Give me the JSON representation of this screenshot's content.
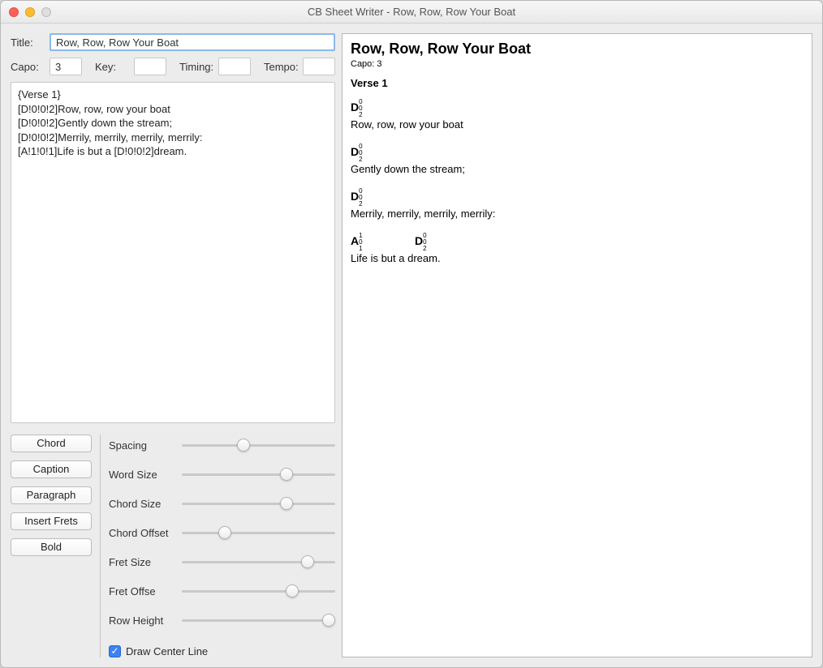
{
  "window": {
    "title": "CB Sheet Writer - Row, Row, Row Your Boat"
  },
  "form": {
    "title_label": "Title:",
    "title_value": "Row, Row, Row Your Boat",
    "capo_label": "Capo:",
    "capo_value": "3",
    "key_label": "Key:",
    "key_value": "",
    "timing_label": "Timing:",
    "timing_value": "",
    "tempo_label": "Tempo:",
    "tempo_value": ""
  },
  "editor_text": "{Verse 1}\n[D!0!0!2]Row, row, row your boat\n[D!0!0!2]Gently down the stream;\n[D!0!0!2]Merrily, merrily, merrily, merrily:\n[A!1!0!1]Life is but a [D!0!0!2]dream.",
  "buttons": {
    "chord": "Chord",
    "caption": "Caption",
    "paragraph": "Paragraph",
    "insert_frets": "Insert Frets",
    "bold": "Bold"
  },
  "sliders": [
    {
      "label": "Spacing",
      "pos": 40
    },
    {
      "label": "Word Size",
      "pos": 68
    },
    {
      "label": "Chord Size",
      "pos": 68
    },
    {
      "label": "Chord Offset",
      "pos": 28
    },
    {
      "label": "Fret Size",
      "pos": 82
    },
    {
      "label": "Fret Offse",
      "pos": 72
    },
    {
      "label": "Row Height",
      "pos": 96
    }
  ],
  "checkbox": {
    "label": "Draw Center Line",
    "checked": true
  },
  "preview": {
    "title": "Row, Row, Row Your Boat",
    "capo_line": "Capo: 3",
    "section": "Verse 1",
    "lines": [
      {
        "chords": [
          {
            "pos": 0,
            "root": "D",
            "frets": [
              "0",
              "0",
              "2"
            ]
          }
        ],
        "lyric": "Row, row, row your boat"
      },
      {
        "chords": [
          {
            "pos": 0,
            "root": "D",
            "frets": [
              "0",
              "0",
              "2"
            ]
          }
        ],
        "lyric": "Gently down the stream;"
      },
      {
        "chords": [
          {
            "pos": 0,
            "root": "D",
            "frets": [
              "0",
              "0",
              "2"
            ]
          }
        ],
        "lyric": "Merrily, merrily, merrily, merrily:"
      },
      {
        "chords": [
          {
            "pos": 0,
            "root": "A",
            "frets": [
              "1",
              "0",
              "1"
            ]
          },
          {
            "pos": 79,
            "root": "D",
            "frets": [
              "0",
              "0",
              "2"
            ]
          }
        ],
        "lyric": "Life is but a dream."
      }
    ]
  }
}
